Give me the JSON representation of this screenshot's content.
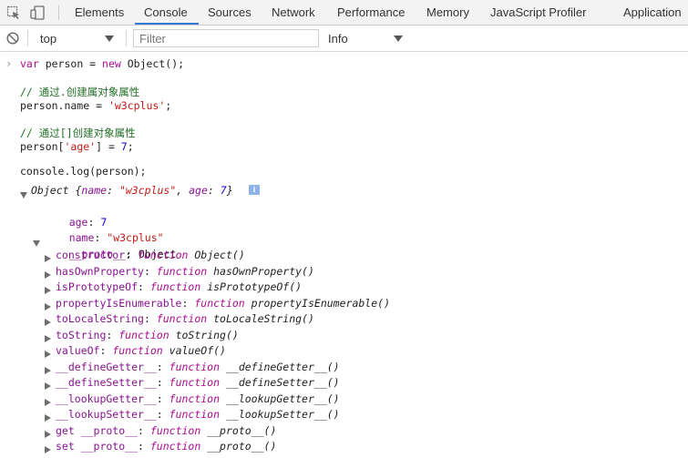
{
  "tabs": [
    "Elements",
    "Console",
    "Sources",
    "Network",
    "Performance",
    "Memory",
    "JavaScript Profiler",
    "Application"
  ],
  "active_tab": "Console",
  "toolbar": {
    "context_value": "top",
    "filter_placeholder": "Filter",
    "level_value": "Info"
  },
  "console": {
    "input_lines": [
      "var person = new Object();",
      "// 通过.创建属对象属性",
      "person.name = 'w3cplus';",
      "// 通过[]创建对象属性",
      "person['age'] = 7;",
      "console.log(person);"
    ],
    "output": {
      "summary": "Object {name: \"w3cplus\", age: 7}",
      "info_badge": "i",
      "age_key": "age",
      "age_value": "7",
      "name_key": "name",
      "name_value": "\"w3cplus\"",
      "proto_key": "__proto__",
      "proto_value": "Object",
      "proto_members": [
        {
          "key": "constructor",
          "sig": "Object()"
        },
        {
          "key": "hasOwnProperty",
          "sig": "hasOwnProperty()"
        },
        {
          "key": "isPrototypeOf",
          "sig": "isPrototypeOf()"
        },
        {
          "key": "propertyIsEnumerable",
          "sig": "propertyIsEnumerable()"
        },
        {
          "key": "toLocaleString",
          "sig": "toLocaleString()"
        },
        {
          "key": "toString",
          "sig": "toString()"
        },
        {
          "key": "valueOf",
          "sig": "valueOf()"
        },
        {
          "key": "__defineGetter__",
          "sig": "__defineGetter__()"
        },
        {
          "key": "__defineSetter__",
          "sig": "__defineSetter__()"
        },
        {
          "key": "__lookupGetter__",
          "sig": "__lookupGetter__()"
        },
        {
          "key": "__lookupSetter__",
          "sig": "__lookupSetter__()"
        },
        {
          "key": "get __proto__",
          "sig": "__proto__()"
        },
        {
          "key": "set __proto__",
          "sig": "__proto__()"
        }
      ],
      "function_keyword": "function"
    }
  },
  "colors": {
    "keyword": "#aa0d91",
    "comment": "#236e25",
    "string": "#c41a16",
    "number": "#1c00cf",
    "accent": "#3879d9"
  },
  "icons": [
    "inspect-element-icon",
    "device-toolbar-icon",
    "clear-console-icon",
    "dropdown-arrow-icon",
    "expand-triangle-icon",
    "collapse-triangle-icon",
    "info-icon"
  ]
}
